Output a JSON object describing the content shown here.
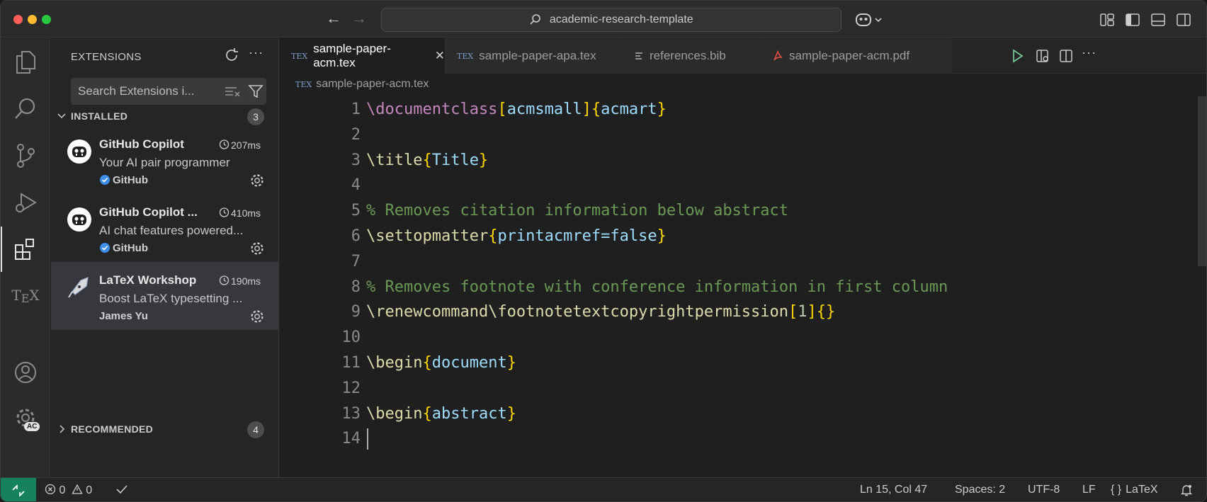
{
  "titlebar": {
    "search_text": "academic-research-template"
  },
  "sidebar": {
    "title": "EXTENSIONS",
    "search_placeholder": "Search Extensions i...",
    "installed": {
      "label": "INSTALLED",
      "count": "3",
      "items": [
        {
          "name": "GitHub Copilot",
          "time": "207ms",
          "description": "Your AI pair programmer",
          "publisher": "GitHub",
          "verified": true
        },
        {
          "name": "GitHub Copilot ...",
          "time": "410ms",
          "description": "AI chat features powered...",
          "publisher": "GitHub",
          "verified": true
        },
        {
          "name": "LaTeX Workshop",
          "time": "190ms",
          "description": "Boost LaTeX typesetting ...",
          "publisher": "James Yu",
          "verified": false
        }
      ]
    },
    "recommended": {
      "label": "RECOMMENDED",
      "count": "4"
    }
  },
  "account_badge": "AC",
  "editor": {
    "tabs": [
      {
        "label": "sample-paper-acm.tex",
        "icon": "tex-icon",
        "active": true
      },
      {
        "label": "sample-paper-apa.tex",
        "icon": "tex-icon",
        "active": false
      },
      {
        "label": "references.bib",
        "icon": "lines-icon",
        "active": false
      },
      {
        "label": "sample-paper-acm.pdf",
        "icon": "pdf-icon",
        "active": false
      }
    ],
    "breadcrumb": "sample-paper-acm.tex",
    "lines": [
      {
        "n": "1",
        "tokens": [
          [
            "c-dc",
            "\\documentclass"
          ],
          [
            "c-br",
            "["
          ],
          [
            "c-arg",
            "acmsmall"
          ],
          [
            "c-br",
            "]"
          ],
          [
            "c-br",
            "{"
          ],
          [
            "c-arg",
            "acmart"
          ],
          [
            "c-br",
            "}"
          ]
        ]
      },
      {
        "n": "2",
        "tokens": []
      },
      {
        "n": "3",
        "tokens": [
          [
            "c-cmd",
            "\\title"
          ],
          [
            "c-br",
            "{"
          ],
          [
            "c-tx",
            "Title"
          ],
          [
            "c-br",
            "}"
          ]
        ]
      },
      {
        "n": "4",
        "tokens": []
      },
      {
        "n": "5",
        "tokens": [
          [
            "c-cm",
            "% Removes citation information below abstract"
          ]
        ]
      },
      {
        "n": "6",
        "tokens": [
          [
            "c-cmd",
            "\\settopmatter"
          ],
          [
            "c-br",
            "{"
          ],
          [
            "c-tx",
            "printacmref=false"
          ],
          [
            "c-br",
            "}"
          ]
        ]
      },
      {
        "n": "7",
        "tokens": []
      },
      {
        "n": "8",
        "tokens": [
          [
            "c-cm",
            "% Removes footnote with conference information in first column"
          ]
        ]
      },
      {
        "n": "9",
        "tokens": [
          [
            "c-cmd",
            "\\renewcommand\\footnotetextcopyrightpermission"
          ],
          [
            "c-br",
            "["
          ],
          [
            "c-num",
            "1"
          ],
          [
            "c-br",
            "]"
          ],
          [
            "c-br",
            "{}"
          ]
        ]
      },
      {
        "n": "10",
        "tokens": []
      },
      {
        "n": "11",
        "tokens": [
          [
            "c-cmd",
            "\\begin"
          ],
          [
            "c-br",
            "{"
          ],
          [
            "c-arg",
            "document"
          ],
          [
            "c-br",
            "}"
          ]
        ]
      },
      {
        "n": "12",
        "tokens": []
      },
      {
        "n": "13",
        "tokens": [
          [
            "c-cmd",
            "\\begin"
          ],
          [
            "c-br",
            "{"
          ],
          [
            "c-arg",
            "abstract"
          ],
          [
            "c-br",
            "}"
          ]
        ]
      },
      {
        "n": "14",
        "tokens": []
      }
    ]
  },
  "statusbar": {
    "errors": "0",
    "warnings": "0",
    "position": "Ln 15, Col 47",
    "spaces": "Spaces: 2",
    "encoding": "UTF-8",
    "eol": "LF",
    "language": "LaTeX",
    "language_icon": "{ }"
  }
}
